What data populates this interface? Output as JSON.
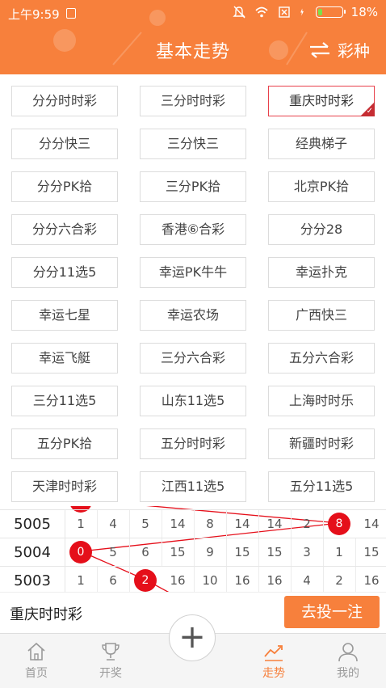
{
  "status_bar": {
    "time": "上午9:59",
    "battery": "18%",
    "battery_level": 0.18
  },
  "header": {
    "title": "基本走势",
    "switch_label": "彩种"
  },
  "games": [
    {
      "label": "分分时时彩"
    },
    {
      "label": "三分时时彩"
    },
    {
      "label": "重庆时时彩",
      "selected": true
    },
    {
      "label": "分分快三"
    },
    {
      "label": "三分快三"
    },
    {
      "label": "经典梯子"
    },
    {
      "label": "分分PK拾"
    },
    {
      "label": "三分PK拾"
    },
    {
      "label": "北京PK拾"
    },
    {
      "label": "分分六合彩"
    },
    {
      "label": "香港⑥合彩"
    },
    {
      "label": "分分28"
    },
    {
      "label": "分分11选5"
    },
    {
      "label": "幸运PK牛牛"
    },
    {
      "label": "幸运扑克"
    },
    {
      "label": "幸运七星"
    },
    {
      "label": "幸运农场"
    },
    {
      "label": "广西快三"
    },
    {
      "label": "幸运飞艇"
    },
    {
      "label": "三分六合彩"
    },
    {
      "label": "五分六合彩"
    },
    {
      "label": "三分11选5"
    },
    {
      "label": "山东11选5"
    },
    {
      "label": "上海时时乐"
    },
    {
      "label": "五分PK拾"
    },
    {
      "label": "五分时时彩"
    },
    {
      "label": "新疆时时彩"
    },
    {
      "label": "天津时时彩"
    },
    {
      "label": "江西11选5"
    },
    {
      "label": "五分11选5"
    }
  ],
  "trend": {
    "rows": [
      {
        "issue": "5005",
        "cells": [
          "1",
          "4",
          "5",
          "14",
          "8",
          "14",
          "14",
          "2",
          "8",
          "14"
        ],
        "ball_index": 8
      },
      {
        "issue": "5004",
        "cells": [
          "0",
          "5",
          "6",
          "15",
          "9",
          "15",
          "15",
          "3",
          "1",
          "15"
        ],
        "ball_index": 0
      },
      {
        "issue": "5003",
        "cells": [
          "1",
          "6",
          "2",
          "16",
          "10",
          "16",
          "16",
          "4",
          "2",
          "16"
        ],
        "ball_index": 2
      }
    ]
  },
  "bet_bar": {
    "current_game": "重庆时时彩",
    "bet_button": "去投一注"
  },
  "tabs": [
    {
      "label": "首页",
      "icon": "home-icon"
    },
    {
      "label": "开奖",
      "icon": "trophy-icon"
    },
    {
      "label": "走势",
      "icon": "trend-icon",
      "active": true
    },
    {
      "label": "我的",
      "icon": "user-icon"
    }
  ],
  "center_button": "+",
  "colors": {
    "accent": "#f7803c",
    "ball": "#e50f1a",
    "selected_border": "#e8414b"
  }
}
